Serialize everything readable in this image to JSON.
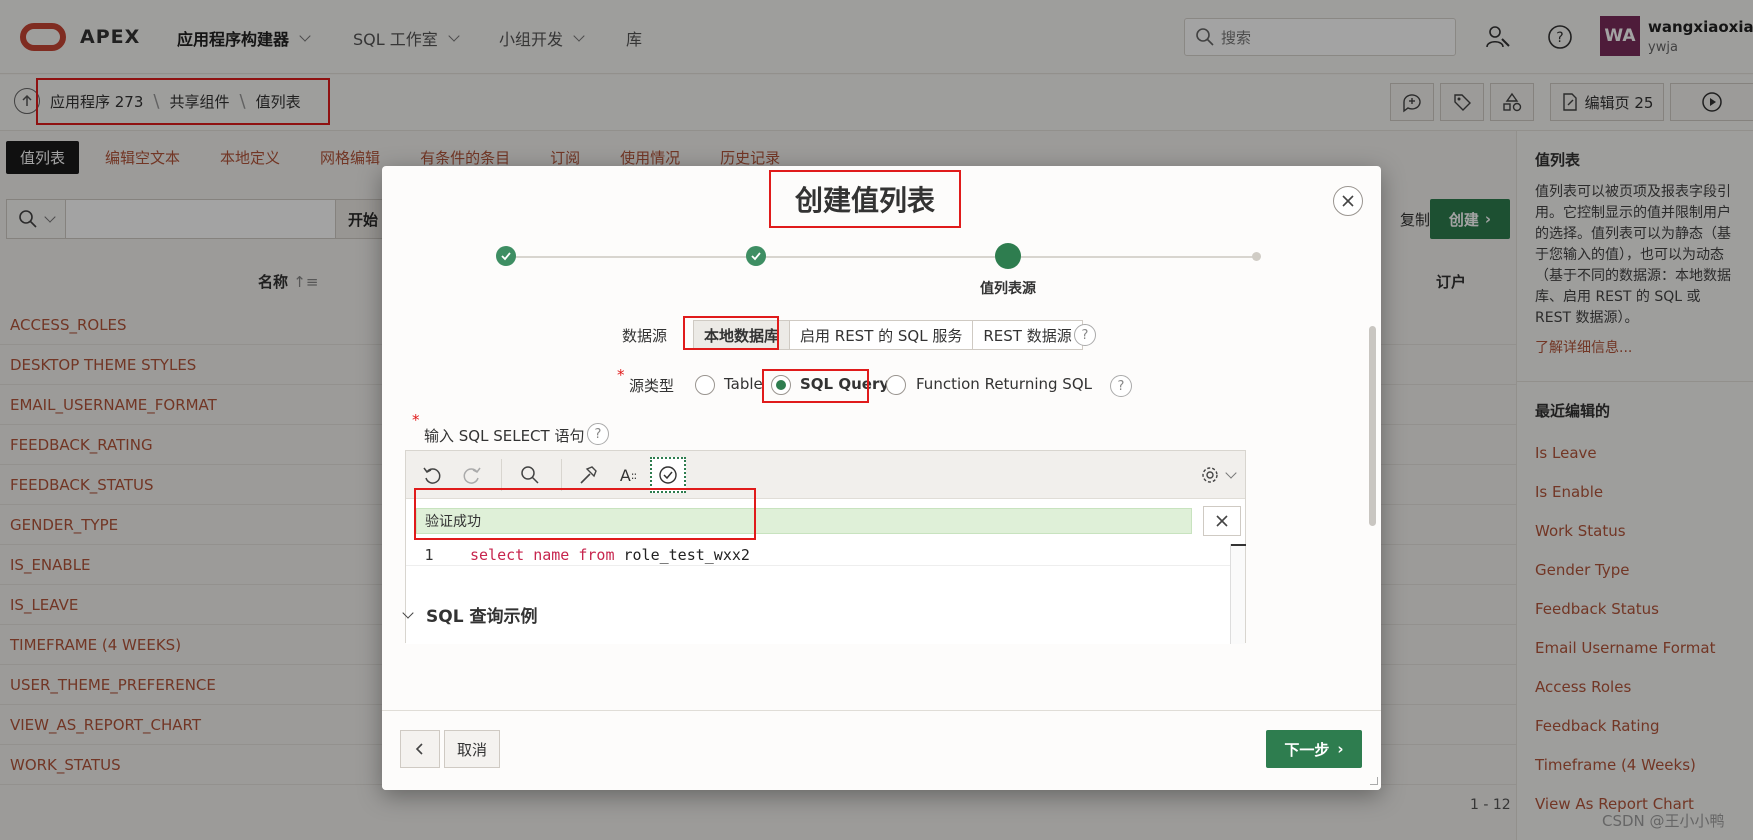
{
  "header": {
    "brand": "APEX",
    "nav": [
      {
        "label": "应用程序构建器"
      },
      {
        "label": "SQL 工作室"
      },
      {
        "label": "小组开发"
      },
      {
        "label": "库"
      }
    ],
    "search_placeholder": "搜索",
    "user_initials": "WA",
    "user_name": "wangxiaoxian",
    "workspace": "ywja"
  },
  "breadcrumb": {
    "items": [
      "应用程序 273",
      "共享组件",
      "值列表"
    ],
    "edit_page_label": "编辑页 25"
  },
  "tabs": [
    "值列表",
    "编辑空文本",
    "本地定义",
    "网格编辑",
    "有条件的条目",
    "订阅",
    "使用情况",
    "历史记录"
  ],
  "toolbar": {
    "go_label": "开始",
    "copy_label": "复制",
    "create_label": "创建"
  },
  "table": {
    "col_name": "名称",
    "col_tenant": "订户",
    "rows": [
      "ACCESS_ROLES",
      "DESKTOP THEME STYLES",
      "EMAIL_USERNAME_FORMAT",
      "FEEDBACK_RATING",
      "FEEDBACK_STATUS",
      "GENDER_TYPE",
      "IS_ENABLE",
      "IS_LEAVE",
      "TIMEFRAME (4 WEEKS)",
      "USER_THEME_PREFERENCE",
      "VIEW_AS_REPORT_CHART",
      "WORK_STATUS"
    ],
    "pagination": "1 - 12"
  },
  "right_panel": {
    "title": "值列表",
    "description": "值列表可以被页项及报表字段引用。它控制显示的值并限制用户的选择。值列表可以为静态（基于您输入的值），也可以为动态（基于不同的数据源：本地数据库、启用 REST 的 SQL 或 REST 数据源）。",
    "more_link": "了解详细信息...",
    "recent_title": "最近编辑的",
    "recent": [
      "Is Leave",
      "Is Enable",
      "Work Status",
      "Gender Type",
      "Feedback Status",
      "Email Username Format",
      "Access Roles",
      "Feedback Rating",
      "Timeframe (4 Weeks)",
      "View As Report Chart"
    ]
  },
  "dialog": {
    "title": "创建值列表",
    "current_step": "值列表源",
    "data_source_label": "数据源",
    "data_source_options": [
      "本地数据库",
      "启用 REST 的 SQL 服务",
      "REST 数据源"
    ],
    "data_source_selected": "本地数据库",
    "source_type_label": "源类型",
    "source_types": [
      "Table",
      "SQL Query",
      "Function Returning SQL"
    ],
    "source_type_selected": "SQL Query",
    "sql_label": "输入 SQL SELECT 语句",
    "validation_message": "验证成功",
    "code_line_number": "1",
    "code_keywords": "select name from",
    "code_table": "role_test_wxx2",
    "examples_label": "SQL 查询示例",
    "cancel_label": "取消",
    "next_label": "下一步"
  },
  "watermark": "CSDN @王小小鸭",
  "colors": {
    "accent_green": "#2e7d4f",
    "link_orange": "#b2553a",
    "annotation_red": "#e01b1b",
    "oracle_red": "#c74634"
  }
}
